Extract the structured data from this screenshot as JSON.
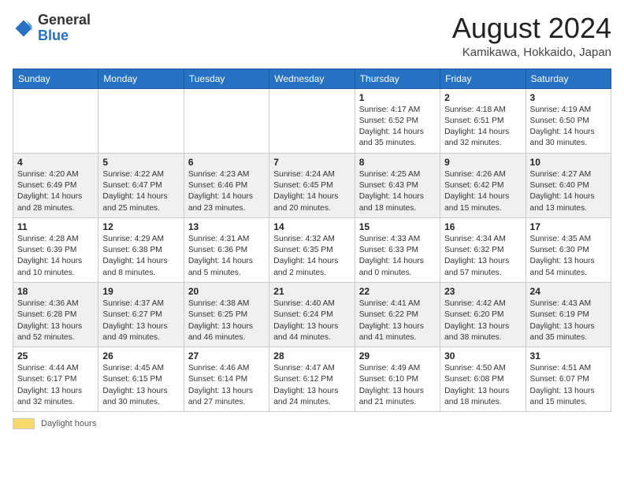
{
  "header": {
    "logo_general": "General",
    "logo_blue": "Blue",
    "month_year": "August 2024",
    "location": "Kamikawa, Hokkaido, Japan"
  },
  "footer": {
    "daylight_label": "Daylight hours"
  },
  "weekdays": [
    "Sunday",
    "Monday",
    "Tuesday",
    "Wednesday",
    "Thursday",
    "Friday",
    "Saturday"
  ],
  "weeks": [
    [
      {
        "day": "",
        "info": ""
      },
      {
        "day": "",
        "info": ""
      },
      {
        "day": "",
        "info": ""
      },
      {
        "day": "",
        "info": ""
      },
      {
        "day": "1",
        "info": "Sunrise: 4:17 AM\nSunset: 6:52 PM\nDaylight: 14 hours and 35 minutes."
      },
      {
        "day": "2",
        "info": "Sunrise: 4:18 AM\nSunset: 6:51 PM\nDaylight: 14 hours and 32 minutes."
      },
      {
        "day": "3",
        "info": "Sunrise: 4:19 AM\nSunset: 6:50 PM\nDaylight: 14 hours and 30 minutes."
      }
    ],
    [
      {
        "day": "4",
        "info": "Sunrise: 4:20 AM\nSunset: 6:49 PM\nDaylight: 14 hours and 28 minutes."
      },
      {
        "day": "5",
        "info": "Sunrise: 4:22 AM\nSunset: 6:47 PM\nDaylight: 14 hours and 25 minutes."
      },
      {
        "day": "6",
        "info": "Sunrise: 4:23 AM\nSunset: 6:46 PM\nDaylight: 14 hours and 23 minutes."
      },
      {
        "day": "7",
        "info": "Sunrise: 4:24 AM\nSunset: 6:45 PM\nDaylight: 14 hours and 20 minutes."
      },
      {
        "day": "8",
        "info": "Sunrise: 4:25 AM\nSunset: 6:43 PM\nDaylight: 14 hours and 18 minutes."
      },
      {
        "day": "9",
        "info": "Sunrise: 4:26 AM\nSunset: 6:42 PM\nDaylight: 14 hours and 15 minutes."
      },
      {
        "day": "10",
        "info": "Sunrise: 4:27 AM\nSunset: 6:40 PM\nDaylight: 14 hours and 13 minutes."
      }
    ],
    [
      {
        "day": "11",
        "info": "Sunrise: 4:28 AM\nSunset: 6:39 PM\nDaylight: 14 hours and 10 minutes."
      },
      {
        "day": "12",
        "info": "Sunrise: 4:29 AM\nSunset: 6:38 PM\nDaylight: 14 hours and 8 minutes."
      },
      {
        "day": "13",
        "info": "Sunrise: 4:31 AM\nSunset: 6:36 PM\nDaylight: 14 hours and 5 minutes."
      },
      {
        "day": "14",
        "info": "Sunrise: 4:32 AM\nSunset: 6:35 PM\nDaylight: 14 hours and 2 minutes."
      },
      {
        "day": "15",
        "info": "Sunrise: 4:33 AM\nSunset: 6:33 PM\nDaylight: 14 hours and 0 minutes."
      },
      {
        "day": "16",
        "info": "Sunrise: 4:34 AM\nSunset: 6:32 PM\nDaylight: 13 hours and 57 minutes."
      },
      {
        "day": "17",
        "info": "Sunrise: 4:35 AM\nSunset: 6:30 PM\nDaylight: 13 hours and 54 minutes."
      }
    ],
    [
      {
        "day": "18",
        "info": "Sunrise: 4:36 AM\nSunset: 6:28 PM\nDaylight: 13 hours and 52 minutes."
      },
      {
        "day": "19",
        "info": "Sunrise: 4:37 AM\nSunset: 6:27 PM\nDaylight: 13 hours and 49 minutes."
      },
      {
        "day": "20",
        "info": "Sunrise: 4:38 AM\nSunset: 6:25 PM\nDaylight: 13 hours and 46 minutes."
      },
      {
        "day": "21",
        "info": "Sunrise: 4:40 AM\nSunset: 6:24 PM\nDaylight: 13 hours and 44 minutes."
      },
      {
        "day": "22",
        "info": "Sunrise: 4:41 AM\nSunset: 6:22 PM\nDaylight: 13 hours and 41 minutes."
      },
      {
        "day": "23",
        "info": "Sunrise: 4:42 AM\nSunset: 6:20 PM\nDaylight: 13 hours and 38 minutes."
      },
      {
        "day": "24",
        "info": "Sunrise: 4:43 AM\nSunset: 6:19 PM\nDaylight: 13 hours and 35 minutes."
      }
    ],
    [
      {
        "day": "25",
        "info": "Sunrise: 4:44 AM\nSunset: 6:17 PM\nDaylight: 13 hours and 32 minutes."
      },
      {
        "day": "26",
        "info": "Sunrise: 4:45 AM\nSunset: 6:15 PM\nDaylight: 13 hours and 30 minutes."
      },
      {
        "day": "27",
        "info": "Sunrise: 4:46 AM\nSunset: 6:14 PM\nDaylight: 13 hours and 27 minutes."
      },
      {
        "day": "28",
        "info": "Sunrise: 4:47 AM\nSunset: 6:12 PM\nDaylight: 13 hours and 24 minutes."
      },
      {
        "day": "29",
        "info": "Sunrise: 4:49 AM\nSunset: 6:10 PM\nDaylight: 13 hours and 21 minutes."
      },
      {
        "day": "30",
        "info": "Sunrise: 4:50 AM\nSunset: 6:08 PM\nDaylight: 13 hours and 18 minutes."
      },
      {
        "day": "31",
        "info": "Sunrise: 4:51 AM\nSunset: 6:07 PM\nDaylight: 13 hours and 15 minutes."
      }
    ]
  ]
}
